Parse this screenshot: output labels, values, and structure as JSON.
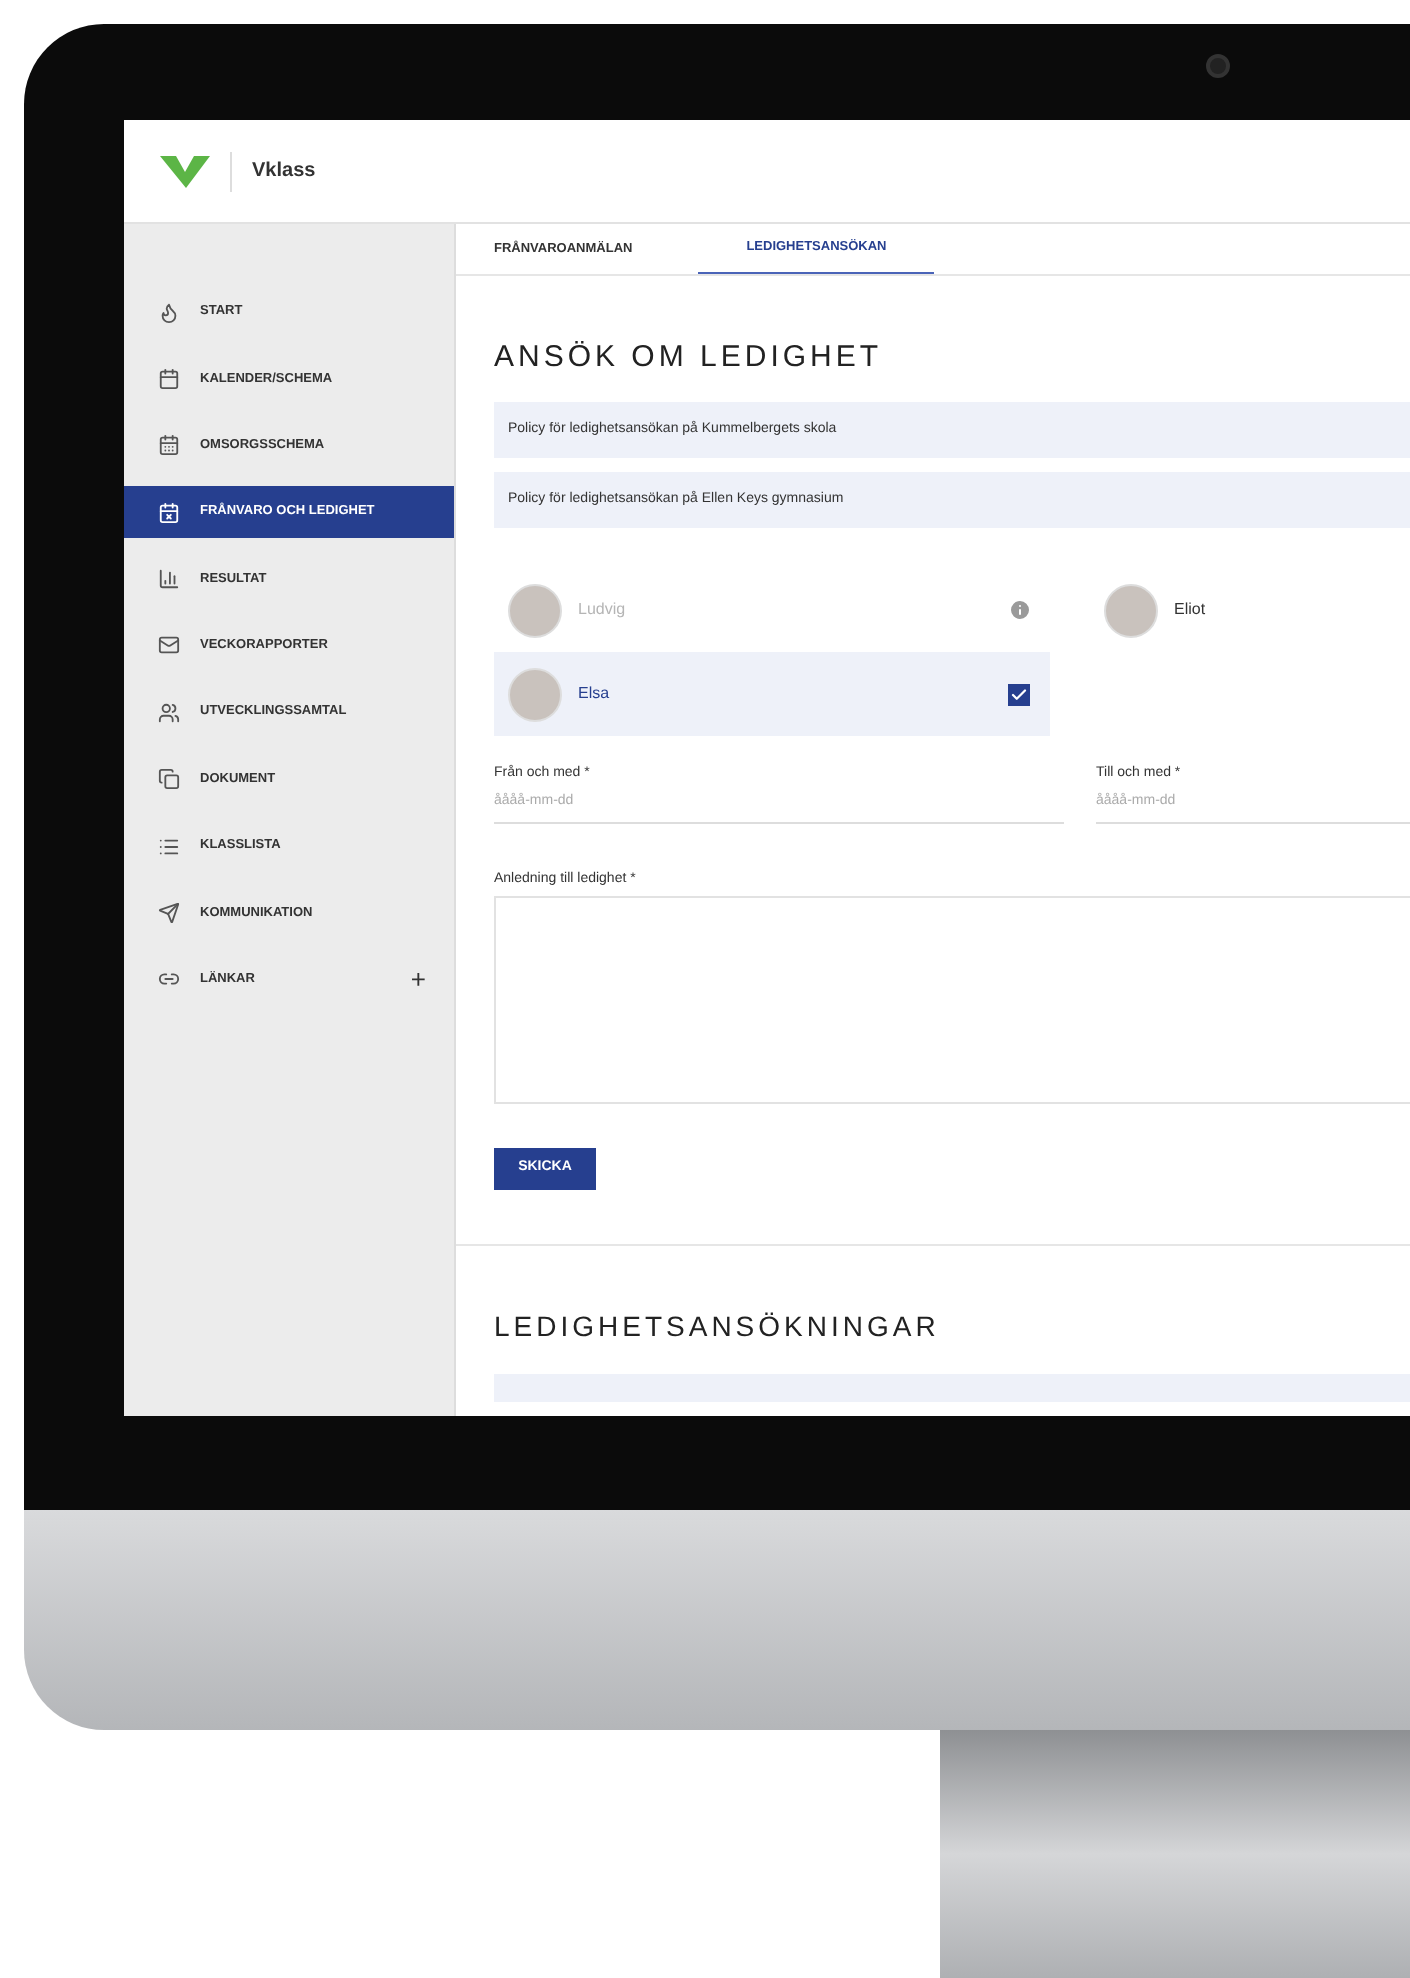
{
  "header": {
    "brand": "Vklass"
  },
  "sidebar": {
    "items": [
      {
        "label": "START",
        "selected": false
      },
      {
        "label": "KALENDER/SCHEMA",
        "selected": false
      },
      {
        "label": "OMSORGSSCHEMA",
        "selected": false
      },
      {
        "label": "FRÅNVARO OCH LEDIGHET",
        "selected": true
      },
      {
        "label": "RESULTAT",
        "selected": false
      },
      {
        "label": "VECKORAPPORTER",
        "selected": false
      },
      {
        "label": "UTVECKLINGSSAMTAL",
        "selected": false
      },
      {
        "label": "DOKUMENT",
        "selected": false
      },
      {
        "label": "KLASSLISTA",
        "selected": false
      },
      {
        "label": "KOMMUNIKATION",
        "selected": false
      },
      {
        "label": "LÄNKAR",
        "selected": false,
        "add": "+"
      }
    ]
  },
  "tabs": [
    {
      "label": "FRÅNVAROANMÄLAN",
      "selected": false
    },
    {
      "label": "LEDIGHETSANSÖKAN",
      "selected": true
    }
  ],
  "form": {
    "title": "ANSÖK OM LEDIGHET",
    "policies": [
      "Policy för ledighetsansökan på Kummelbergets skola",
      "Policy för ledighetsansökan på Ellen Keys gymnasium"
    ],
    "students": [
      {
        "name": "Ludvig",
        "disabled": true,
        "selected": false
      },
      {
        "name": "Eliot",
        "disabled": false,
        "selected": false
      },
      {
        "name": "Elsa",
        "disabled": false,
        "selected": true
      }
    ],
    "date_fields": [
      {
        "label": "Från och med *",
        "placeholder": "åååå-mm-dd"
      },
      {
        "label": "Till och med *",
        "placeholder": "åååå-mm-dd"
      }
    ],
    "reason": {
      "label": "Anledning till ledighet *"
    },
    "submit": "SKICKA"
  },
  "applications": {
    "title": "LEDIGHETSANSÖKNINGAR"
  }
}
